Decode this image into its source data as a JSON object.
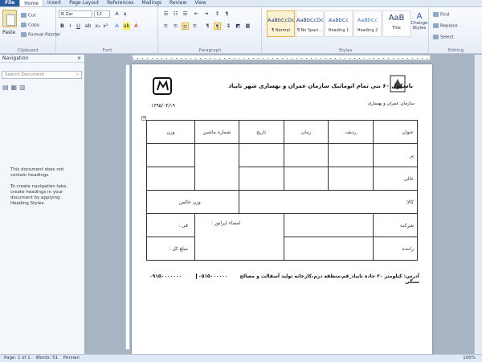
{
  "tabs": [
    "File",
    "Home",
    "Insert",
    "Page Layout",
    "References",
    "Mailings",
    "Review",
    "View"
  ],
  "ribbon": {
    "clipboard": {
      "paste": "Paste",
      "cut": "Cut",
      "copy": "Copy",
      "format_painter": "Format Painter",
      "label": "Clipboard"
    },
    "font": {
      "name": "B Zar",
      "size": "12",
      "label": "Font"
    },
    "paragraph": {
      "label": "Paragraph"
    },
    "styles": {
      "label": "Styles",
      "items": [
        {
          "preview": "AaBbCcDc",
          "name": "¶ Normal"
        },
        {
          "preview": "AaBbCcDc",
          "name": "¶ No Spaci..."
        },
        {
          "preview": "AaBbCc",
          "name": "Heading 1"
        },
        {
          "preview": "AaBbCc",
          "name": "Heading 2"
        },
        {
          "preview": "AaB",
          "name": "Title"
        }
      ],
      "change_styles": "Change Styles"
    },
    "editing": {
      "find": "Find",
      "replace": "Replace",
      "select": "Select",
      "label": "Editing"
    }
  },
  "navigation": {
    "title": "Navigation",
    "search_placeholder": "Search Document",
    "msg1": "This document does not contain headings.",
    "msg2": "To create navigation tabs, create headings in your document by applying Heading Styles."
  },
  "document": {
    "title": "باسکول ۶۰ تنی تمام اتوماتیک سازمان عمران و بهسازی شهر تایباد",
    "org_caption": "سازمان عمران و بهسازی",
    "date": "۱۳۹۵/۰۴/۱۹",
    "headers": [
      "عنوان",
      "ردیف",
      "زمان",
      "تاریخ",
      "شماره ماشین",
      "وزن"
    ],
    "row_full": "پر",
    "row_empty": "خالی",
    "goods": "کالا:",
    "net_weight": "وزن خالص",
    "company": "شرکت",
    "driver": "راننده",
    "operator_sign": "امضاء اپراتور :",
    "unit_price": "فی :",
    "total": "مبلغ کل :",
    "address": "آدرس: کیلومتر ۲۰ جاده تایباد_قم،منطقه درم،کارخانه تولید آسفالت و مصالح سنگی",
    "phone1": "۰۵۱۵۰۰۰۰۰۰",
    "phone2": "۰۹۱۵۰۰۰۰۰۰۰"
  },
  "status": {
    "page": "Page: 1 of 1",
    "words": "Words: 51",
    "language": "Persian",
    "zoom": "100%"
  }
}
